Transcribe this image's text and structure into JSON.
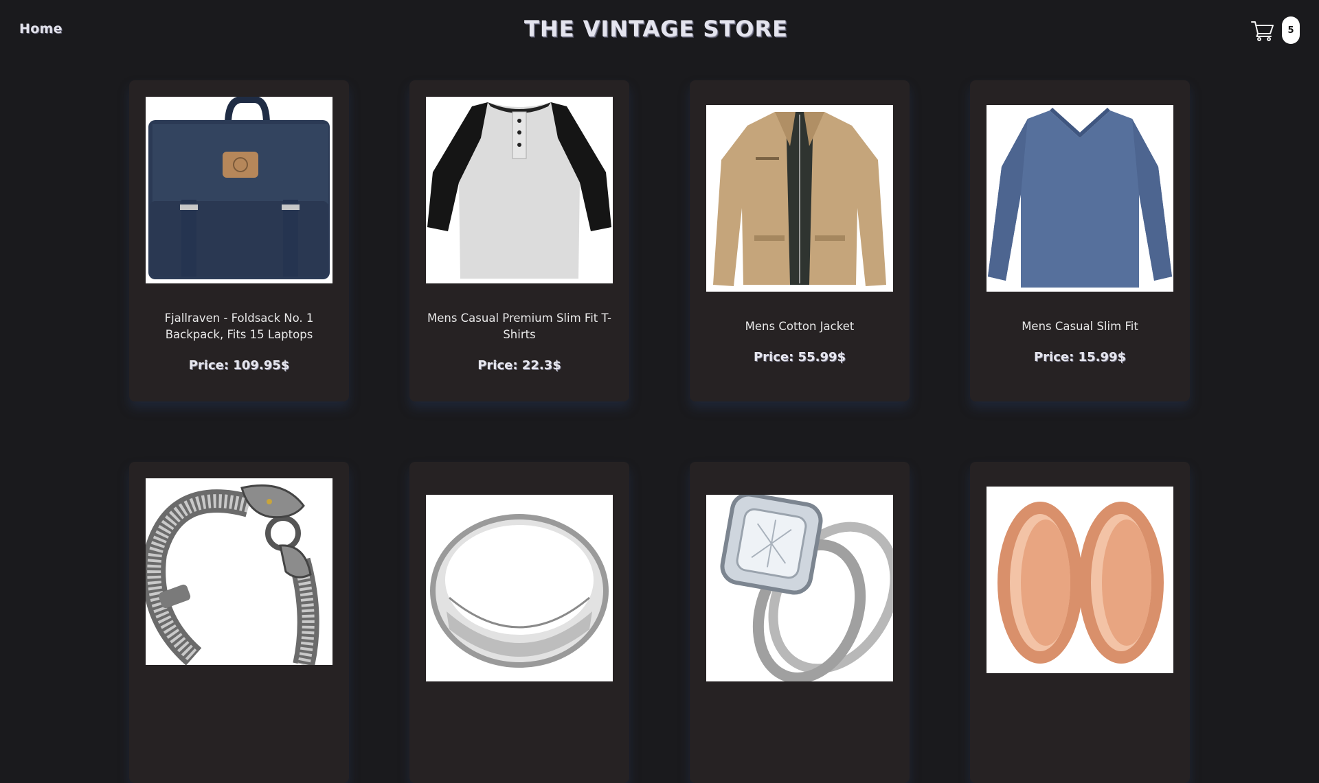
{
  "nav": {
    "home_label": "Home"
  },
  "header": {
    "title": "THE VINTAGE STORE"
  },
  "cart": {
    "icon": "shopping-cart-icon",
    "count": "5"
  },
  "products": [
    {
      "name": "Fjallraven - Foldsack No. 1 Backpack, Fits 15 Laptops",
      "price": "Price: 109.95$",
      "image": "navy backpack"
    },
    {
      "name": "Mens Casual Premium Slim Fit T-Shirts",
      "price": "Price: 22.3$",
      "image": "raglan henley t-shirt"
    },
    {
      "name": "Mens Cotton Jacket",
      "price": "Price: 55.99$",
      "image": "khaki cotton jacket"
    },
    {
      "name": "Mens Casual Slim Fit",
      "price": "Price: 15.99$",
      "image": "blue long sleeve shirt"
    },
    {
      "name": "",
      "price": "",
      "image": "silver dragon bracelet"
    },
    {
      "name": "",
      "price": "",
      "image": "silver band ring"
    },
    {
      "name": "",
      "price": "",
      "image": "diamond ring set"
    },
    {
      "name": "",
      "price": "",
      "image": "rose gold tunnel earrings"
    }
  ],
  "colors": {
    "background": "#1a1a1d",
    "card": "#262223",
    "text": "#e8e8e8"
  }
}
